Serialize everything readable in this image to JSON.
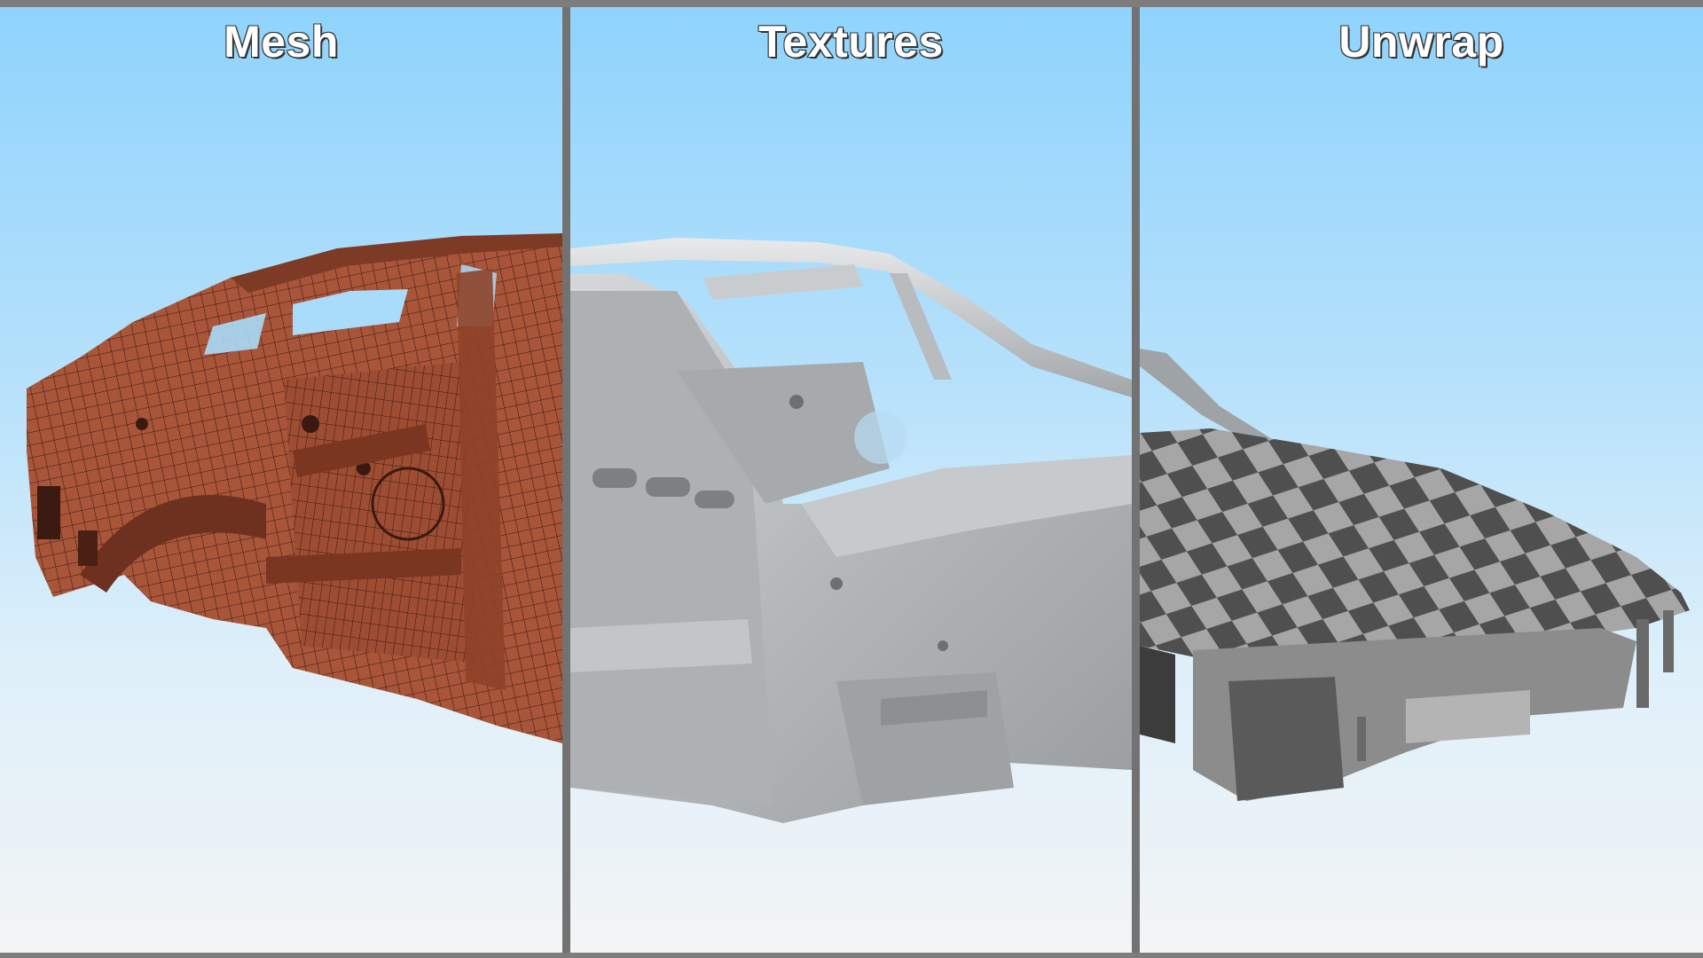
{
  "panels": [
    {
      "label": "Mesh",
      "icon": "wireframe-car-body",
      "color": "#a8553a"
    },
    {
      "label": "Textures",
      "icon": "metal-car-body",
      "color": "#b5b8bb"
    },
    {
      "label": "Unwrap",
      "icon": "uv-checker-car-body",
      "color": "#5a5a5a"
    }
  ]
}
